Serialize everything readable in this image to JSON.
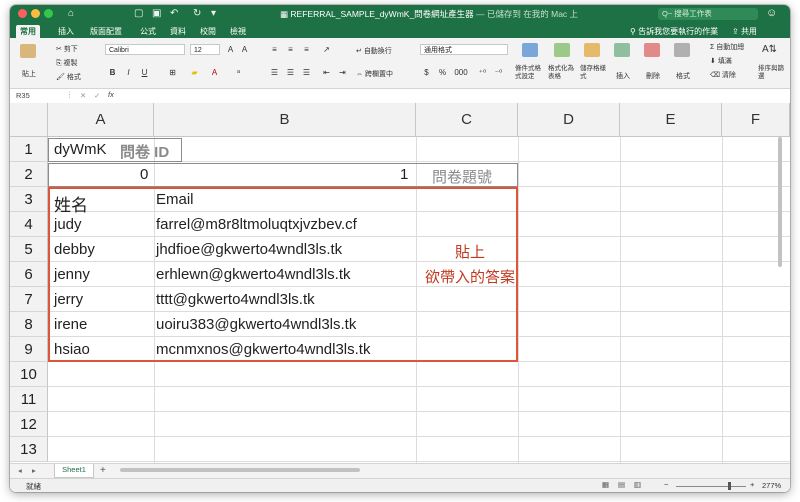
{
  "titlebar": {
    "doc_name": "REFERRAL_SAMPLE_dyWmK_問卷網址產生器",
    "doc_status": " — 已儲存到 在我的 Mac 上",
    "search_placeholder": "Q~ 搜尋工作表"
  },
  "tabs": [
    "常用",
    "插入",
    "版面配置",
    "公式",
    "資料",
    "校閱",
    "檢視"
  ],
  "tell_me": "告訴我您要執行的作業",
  "share": "共用",
  "ribbon": {
    "paste": "貼上",
    "cut": "剪下",
    "copy": "複製",
    "format_painter": "格式",
    "font_name": "Calibri",
    "font_size": "12",
    "bold": "B",
    "italic": "I",
    "underline": "U",
    "wrap_text": "自動換行",
    "merge_center": "跨欄置中",
    "number_format": "通用格式",
    "currency": "$",
    "percent": "%",
    "thousands": "000",
    "conditional_format": "條件式格式設定",
    "format_as_table": "格式化為表格",
    "cell_styles": "儲存格樣式",
    "insert": "插入",
    "delete": "刪除",
    "format": "格式",
    "autosum": "自動加總",
    "fill": "填滿",
    "clear": "清除",
    "sort_filter": "排序與篩選"
  },
  "formula_bar": {
    "name_box": "R35",
    "cancel": "✕",
    "confirm": "✓",
    "fx": "fx",
    "value": ""
  },
  "grid": {
    "columns": [
      "A",
      "B",
      "C",
      "D",
      "E",
      "F"
    ],
    "rows": [
      "1",
      "2",
      "3",
      "4",
      "5",
      "6",
      "7",
      "8",
      "9",
      "10",
      "11",
      "12",
      "13"
    ],
    "a1_text": "dyWmK",
    "a1_label": "問卷 ID",
    "a2": "0",
    "b2": "1",
    "c2": "問卷題號",
    "header_name": "姓名",
    "header_email": "Email",
    "entries": [
      {
        "name": "judy",
        "email": "farrel@m8r8ltmoluqtxjvzbev.cf"
      },
      {
        "name": "debby",
        "email": "jhdfioe@gkwerto4wndl3ls.tk"
      },
      {
        "name": "jenny",
        "email": "erhlewn@gkwerto4wndl3ls.tk"
      },
      {
        "name": "jerry",
        "email": "tttt@gkwerto4wndl3ls.tk"
      },
      {
        "name": "irene",
        "email": "uoiru383@gkwerto4wndl3ls.tk"
      },
      {
        "name": "hsiao",
        "email": "mcnmxnos@gkwerto4wndl3ls.tk"
      }
    ],
    "note_line1": "貼上",
    "note_line2": "欲帶入的答案"
  },
  "sheets": {
    "active": "Sheet1",
    "add": "+"
  },
  "status": {
    "ready": "就緒",
    "zoom": "277%",
    "minus": "−",
    "plus": "+"
  },
  "colors": {
    "excel_green": "#1e7145",
    "annotation_red": "#e0543a",
    "annotation_text": "#c0391e"
  }
}
